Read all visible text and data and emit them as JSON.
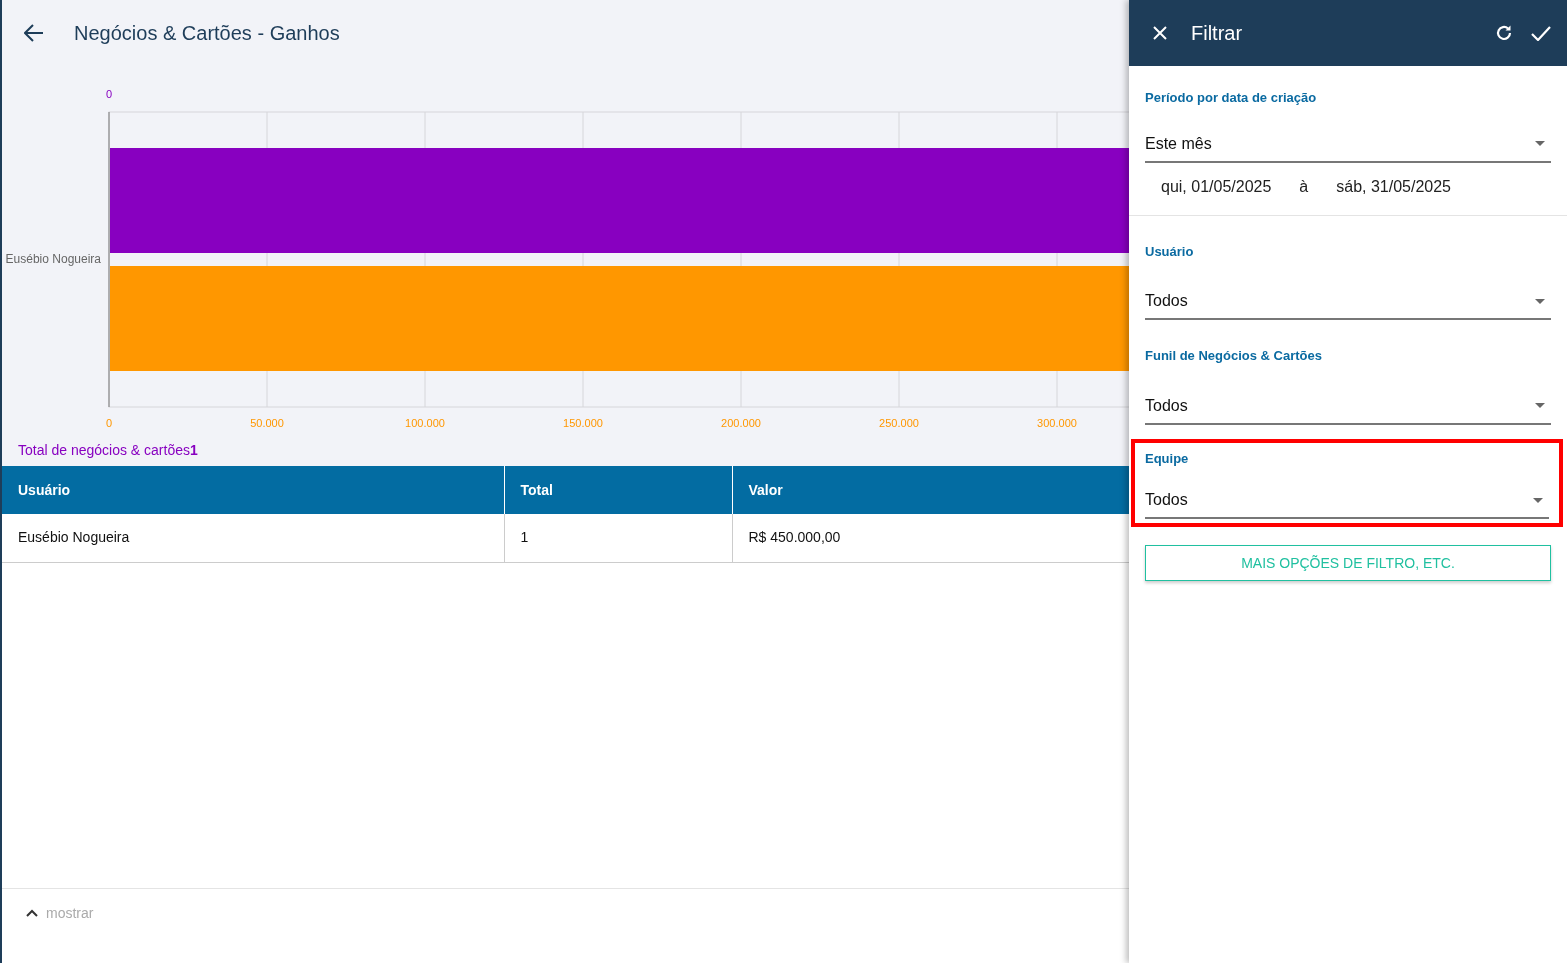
{
  "header": {
    "title": "Negócios & Cartões - Ganhos"
  },
  "chart": {
    "top_axis_labels": [
      "0"
    ],
    "category_labels": [
      "Eusébio Nogueira"
    ],
    "bottom_axis_labels": [
      "0",
      "50.000",
      "100.000",
      "150.000",
      "200.000",
      "250.000",
      "300.000"
    ]
  },
  "summary": {
    "label": "Total de negócios & cartões",
    "value": "1"
  },
  "table": {
    "columns": [
      "Usuário",
      "Total",
      "Valor"
    ],
    "rows": [
      [
        "Eusébio Nogueira",
        "1",
        "R$ 450.000,00"
      ]
    ]
  },
  "footer": {
    "toggle": "mostrar"
  },
  "filter_panel": {
    "title": "Filtrar",
    "sections": [
      {
        "label": "Período por data de criação",
        "value": "Este mês",
        "date_from": "qui, 01/05/2025",
        "separator": "à",
        "date_to": "sáb, 31/05/2025",
        "highlighted": false
      },
      {
        "label": "Usuário",
        "value": "Todos",
        "highlighted": false
      },
      {
        "label": "Funil de Negócios & Cartões",
        "value": "Todos",
        "highlighted": false
      },
      {
        "label": "Equipe",
        "value": "Todos",
        "highlighted": true
      }
    ],
    "more_button": "MAIS OPÇÕES DE FILTRO, ETC."
  }
}
